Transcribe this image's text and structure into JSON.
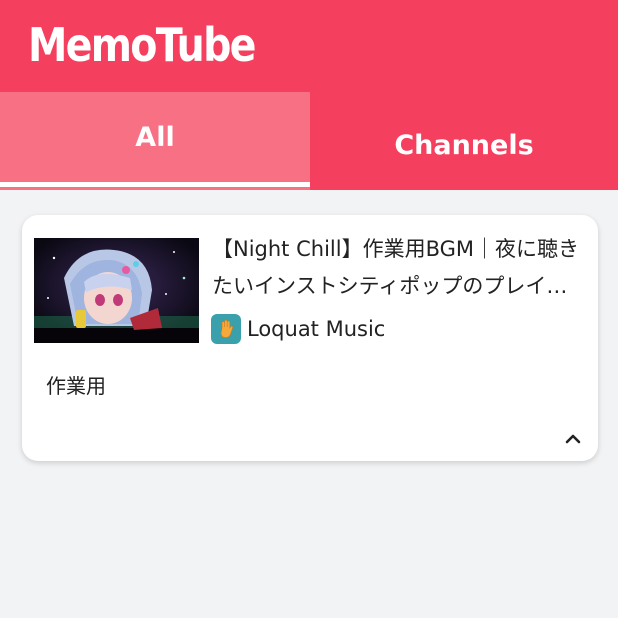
{
  "app": {
    "title": "MemoTube"
  },
  "tabs": [
    {
      "label": "All",
      "active": true
    },
    {
      "label": "Channels",
      "active": false
    }
  ],
  "video": {
    "title": "【Night Chill】作業用BGM｜夜に聴きたいインストシティポップのプレイリスト",
    "channel": "Loquat Music",
    "memo": "作業用"
  },
  "icons": {
    "channel_avatar": "hand-icon",
    "collapse": "chevron-up-icon"
  },
  "colors": {
    "brand": "#f43f5e",
    "active_tab": "#f87084",
    "avatar_bg": "#3aa1ac",
    "page_bg": "#f2f3f5"
  }
}
